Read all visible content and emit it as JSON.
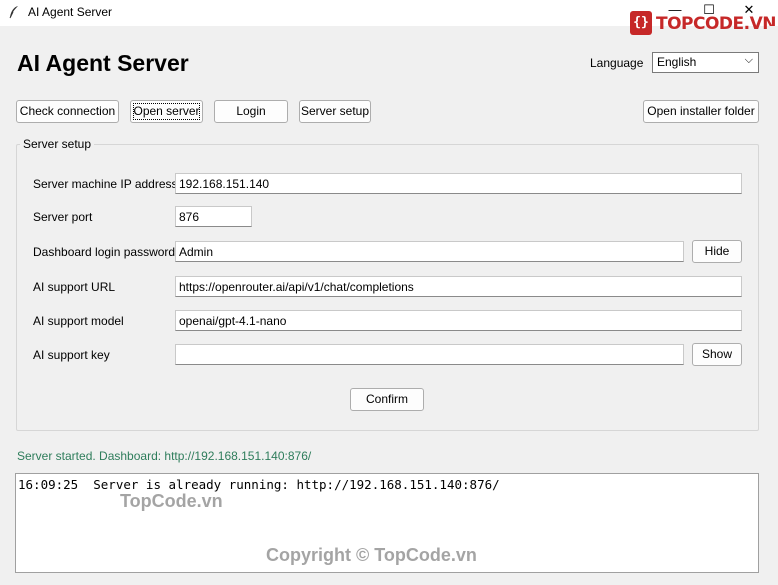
{
  "window": {
    "title": "AI Agent Server",
    "controls": {
      "minimize": "—",
      "maximize": "☐",
      "close": "✕"
    }
  },
  "watermark": {
    "logo_badge": "{}",
    "logo_text": "TOPCODE.VN",
    "text1": "TopCode.vn",
    "text2": "Copyright © TopCode.vn",
    "brand_color": "#c62828"
  },
  "header": {
    "title": "AI Agent Server",
    "language_label": "Language",
    "language_value": "English"
  },
  "toolbar": {
    "check_connection": "Check connection",
    "open_server": "Open server",
    "login": "Login",
    "server_setup": "Server setup",
    "open_installer_folder": "Open installer folder"
  },
  "setup": {
    "legend": "Server setup",
    "ip_label": "Server machine IP address",
    "ip_value": "192.168.151.140",
    "port_label": "Server port",
    "port_value": "876",
    "password_label": "Dashboard login password",
    "password_value": "Admin",
    "hide_button": "Hide",
    "ai_url_label": "AI support URL",
    "ai_url_value": "https://openrouter.ai/api/v1/chat/completions",
    "ai_model_label": "AI support model",
    "ai_model_value": "openai/gpt-4.1-nano",
    "ai_key_label": "AI support key",
    "ai_key_value": "",
    "show_button": "Show",
    "confirm_button": "Confirm"
  },
  "status": {
    "message": "Server started. Dashboard: http://192.168.151.140:876/",
    "color": "#2e7d5b"
  },
  "log": {
    "lines": "16:09:25  Server is already running: http://192.168.151.140:876/"
  }
}
